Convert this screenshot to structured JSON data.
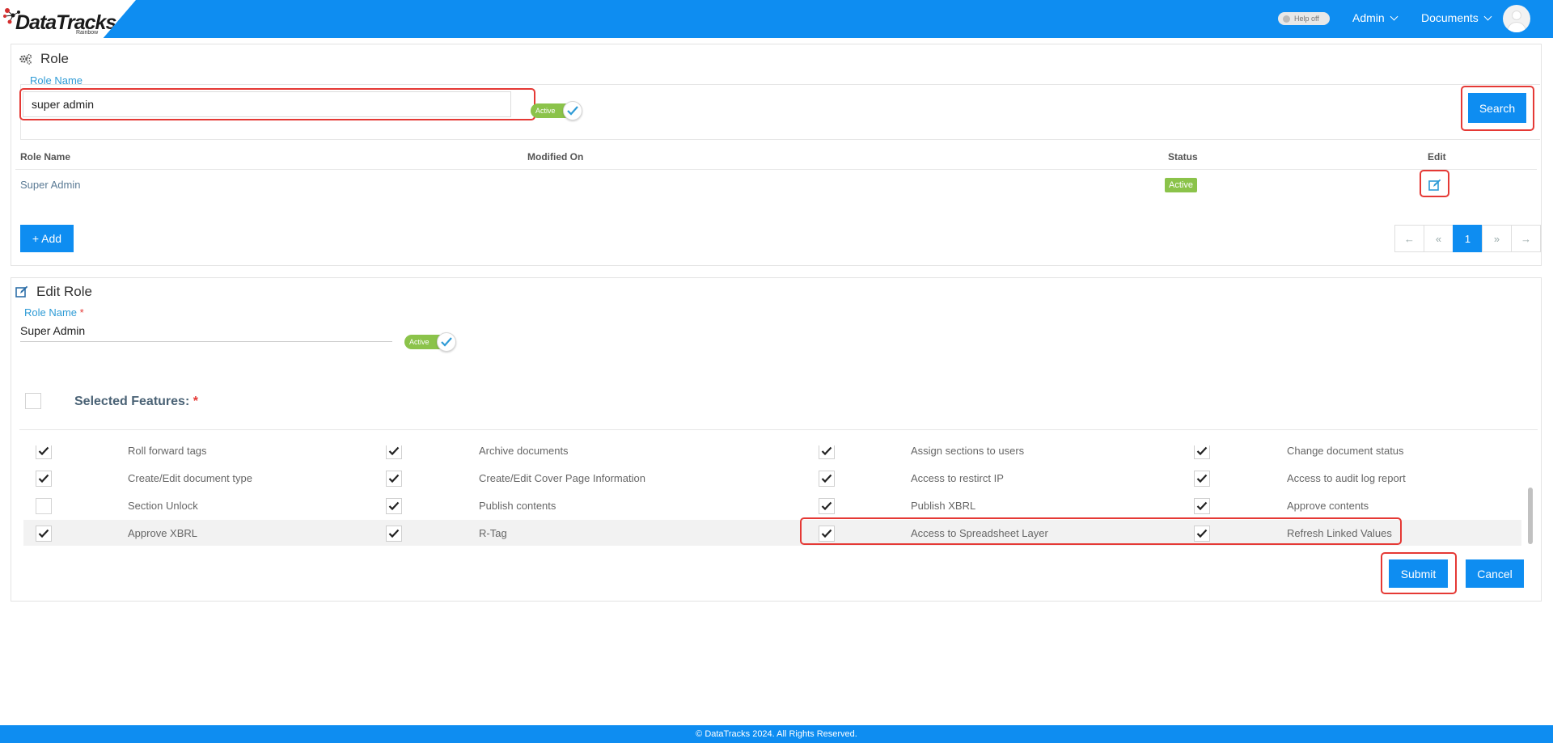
{
  "header": {
    "logo_text": "DataTracks",
    "logo_sub": "Rainbow",
    "help_toggle": "Help off",
    "admin_menu": "Admin",
    "documents_menu": "Documents"
  },
  "role_panel": {
    "title": "Role",
    "role_name_label": "Role Name",
    "role_name_value": "super admin",
    "active_toggle": "Active",
    "search_button": "Search",
    "table": {
      "headers": [
        "Role Name",
        "Modified On",
        "Status",
        "Edit"
      ],
      "rows": [
        {
          "role_name": "Super Admin",
          "modified_on": "",
          "status": "Active"
        }
      ]
    },
    "add_button": "+ Add",
    "pagination": [
      "←",
      "«",
      "1",
      "»",
      "→"
    ],
    "current_page": "1"
  },
  "edit_panel": {
    "title": "Edit Role",
    "role_name_label": "Role Name",
    "required_mark": "*",
    "role_name_value": "Super Admin",
    "active_toggle": "Active",
    "selected_features_label": "Selected Features:",
    "features": [
      [
        {
          "label": "Roll forward tags",
          "checked": true
        },
        {
          "label": "Archive documents",
          "checked": true
        },
        {
          "label": "Assign sections to users",
          "checked": true
        },
        {
          "label": "Change document status",
          "checked": true
        }
      ],
      [
        {
          "label": "Create/Edit document type",
          "checked": true
        },
        {
          "label": "Create/Edit Cover Page Information",
          "checked": true
        },
        {
          "label": "Access to restirct IP",
          "checked": true
        },
        {
          "label": "Access to audit log report",
          "checked": true
        }
      ],
      [
        {
          "label": "Section Unlock",
          "checked": false
        },
        {
          "label": "Publish contents",
          "checked": true
        },
        {
          "label": "Publish XBRL",
          "checked": true
        },
        {
          "label": "Approve contents",
          "checked": true
        }
      ],
      [
        {
          "label": "Approve XBRL",
          "checked": true
        },
        {
          "label": "R-Tag",
          "checked": true
        },
        {
          "label": "Access to Spreadsheet Layer",
          "checked": true
        },
        {
          "label": "Refresh Linked Values",
          "checked": true
        }
      ]
    ],
    "submit_button": "Submit",
    "cancel_button": "Cancel"
  },
  "footer": {
    "copyright": "© DataTracks 2024. All Rights Reserved."
  },
  "colors": {
    "brand_blue": "#0e8df1",
    "active_green": "#8bc34a",
    "highlight_red": "#e53935",
    "label_blue": "#2e9bd6"
  }
}
